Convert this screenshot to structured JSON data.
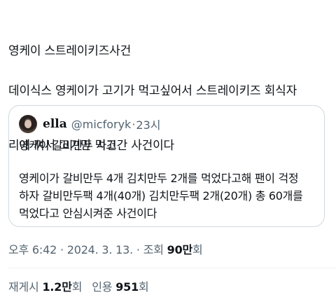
{
  "tweet": {
    "headline": "영케이 스트레이키즈사건",
    "body_lines": [
      "데이식스 영케이가 고기가 먹고싶어서 스트레이키즈 회식자",
      "리에 껴서 고기만 먹고간 사건이다"
    ]
  },
  "quote": {
    "name": "ella",
    "handle": "@micforyk",
    "separator": "·",
    "time": "23시",
    "title": "영케이 갈비만두 사건",
    "body_lines": [
      "영케이가 갈비만두 4개 김치만두 2개를 먹었다고해 팬이 걱정",
      "하자 갈비만두팩 4개(40개) 김치만두팩 2개(20개) 총 60개를",
      "먹었다고 안심시켜준 사건이다"
    ]
  },
  "meta": {
    "time": "오후 6:42",
    "sep1": " · ",
    "date": "2024. 3. 13.",
    "sep2": " · ",
    "views_label": "조회",
    "views_value": "90",
    "views_unit": "만",
    "views_suffix": "회"
  },
  "stats": {
    "retweets_label": "재게시",
    "retweets_value": "1.2",
    "retweets_unit": "만",
    "retweets_suffix": "회",
    "quotes_label": "인용",
    "quotes_value": "951",
    "quotes_suffix": "회"
  },
  "colors": {
    "text": "#0f1419",
    "secondary": "#536471",
    "border": "#cfd9de"
  }
}
